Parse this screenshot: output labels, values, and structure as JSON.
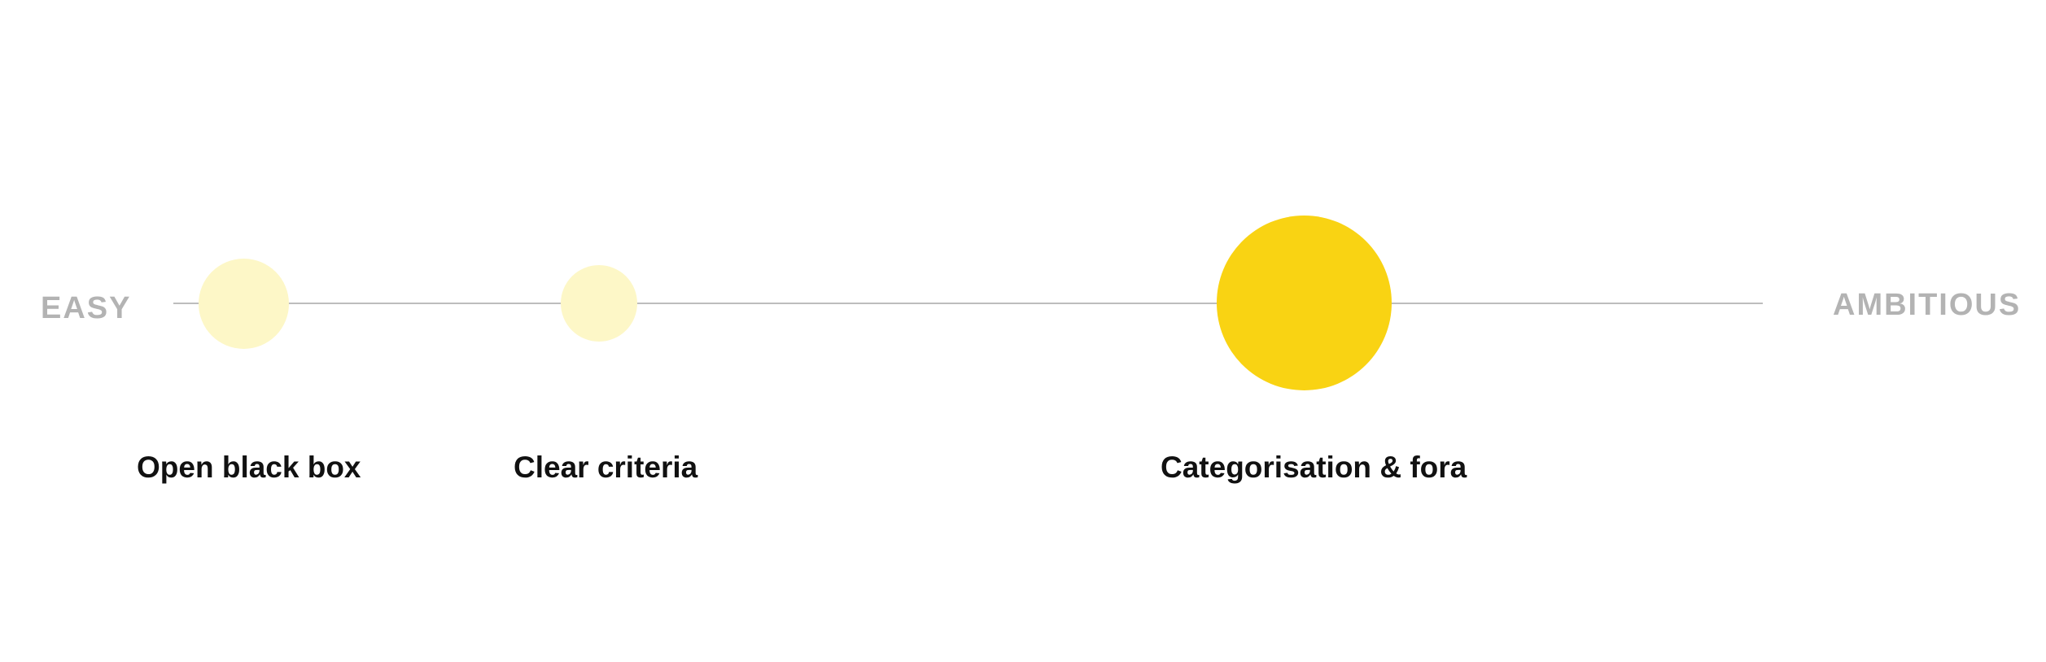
{
  "scale": {
    "start_label": "EASY",
    "end_label": "AMBITIOUS",
    "line_color": "#bdbdbd",
    "label_color": "#b3b3b3"
  },
  "items": [
    {
      "label": "Open black box",
      "color": "#fdf7c7"
    },
    {
      "label": "Clear criteria",
      "color": "#fdf7c7"
    },
    {
      "label": "Categorisation & fora",
      "color": "#f9d313"
    }
  ]
}
